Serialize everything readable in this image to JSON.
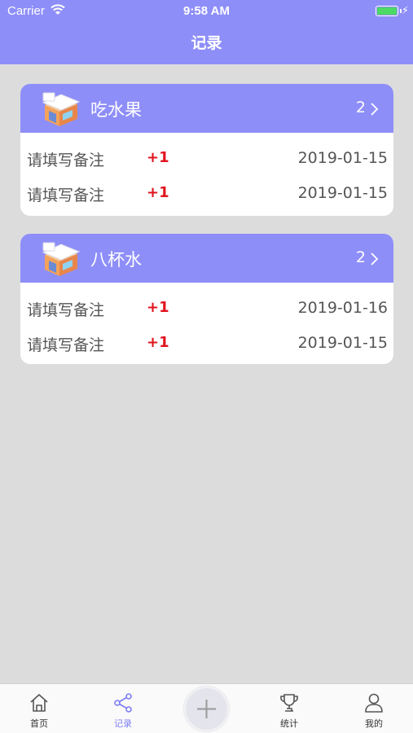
{
  "status_bar": {
    "carrier": "Carrier",
    "time": "9:58 AM",
    "battery_color": "#4cd964"
  },
  "header": {
    "title": "记录",
    "background": "#8e8ef9"
  },
  "cards": [
    {
      "icon": "shop-icon",
      "title": "吃水果",
      "count": "2",
      "records": [
        {
          "note": "请填写备注",
          "delta": "+1",
          "date": "2019-01-15"
        },
        {
          "note": "请填写备注",
          "delta": "+1",
          "date": "2019-01-15"
        }
      ]
    },
    {
      "icon": "shop-icon",
      "title": "八杯水",
      "count": "2",
      "records": [
        {
          "note": "请填写备注",
          "delta": "+1",
          "date": "2019-01-16"
        },
        {
          "note": "请填写备注",
          "delta": "+1",
          "date": "2019-01-15"
        }
      ]
    }
  ],
  "tabbar": {
    "accent": "#7d7df5",
    "delta_color": "#e0141e",
    "tabs": [
      {
        "label": "首页",
        "icon": "home-icon",
        "active": false
      },
      {
        "label": "记录",
        "icon": "share-icon",
        "active": true
      },
      {
        "label": "",
        "icon": "plus-icon",
        "active": false
      },
      {
        "label": "统计",
        "icon": "trophy-icon",
        "active": false
      },
      {
        "label": "我的",
        "icon": "user-icon",
        "active": false
      }
    ]
  }
}
